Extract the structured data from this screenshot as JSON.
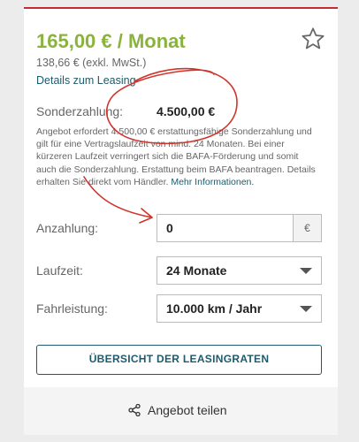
{
  "offer": {
    "monthly_price": "165,00 € / Monat",
    "net_price": "138,66 € (exkl. MwSt.)",
    "details_link": "Details zum Leasing",
    "special_payment_label": "Sonderzahlung:",
    "special_payment_value": "4.500,00 €",
    "info_text": "Angebot erfordert 4.500,00 € erstattungsfähige Sonderzahlung und gilt für eine Vertragslaufzeit von mind. 24 Monaten. Bei einer kürzeren Laufzeit verringert sich die BAFA-Förderung und somit auch die Sonderzahlung. Erstattung beim BAFA beantragen. Details erhalten Sie direkt vom Händler.",
    "info_link": "Mehr Informationen."
  },
  "form": {
    "down_payment_label": "Anzahlung:",
    "down_payment_value": "0",
    "down_payment_unit": "€",
    "duration_label": "Laufzeit:",
    "duration_value": "24 Monate",
    "mileage_label": "Fahrleistung:",
    "mileage_value": "10.000 km / Jahr"
  },
  "actions": {
    "rates_button": "ÜBERSICHT DER LEASINGRATEN",
    "share_label": "Angebot teilen"
  },
  "icons": {
    "favorite": "star-outline-icon",
    "share": "share-icon",
    "dropdown": "chevron-down-icon"
  },
  "colors": {
    "price_green": "#8ab33d",
    "link_teal": "#1d5a6b",
    "top_border_red": "#c62a32",
    "annotation_red": "#d0342c"
  }
}
